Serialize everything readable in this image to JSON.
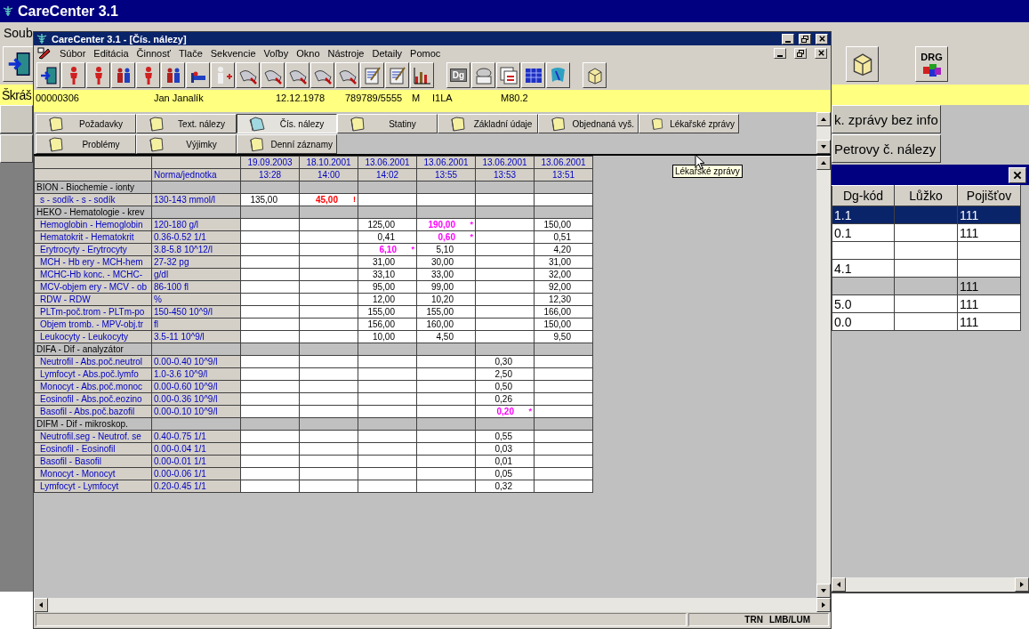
{
  "outer_window": {
    "title": "CareCenter 3.1",
    "menu": [
      "Soub"
    ],
    "toolbar": [
      {
        "kind": "icon"
      },
      {
        "kind": "icon"
      },
      {
        "kind": "label",
        "label": "DRG"
      }
    ],
    "patient_strip": "Škráš",
    "buttons": [
      "k. zprávy bez info",
      "Petrovy č. nálezy"
    ]
  },
  "side_panel": {
    "columns": [
      "Dg-kód",
      "Lůžko",
      "Pojišťov"
    ],
    "rows": [
      {
        "cells": {
          "dg_code": "1.1",
          "insurer": "111"
        },
        "selected": true,
        "shaded": false
      },
      {
        "cells": {
          "dg_code": "0.1",
          "insurer": "111"
        },
        "selected": false,
        "shaded": false
      },
      {
        "cells": {},
        "selected": false,
        "shaded": false
      },
      {
        "cells": {
          "dg_code": "4.1"
        },
        "selected": false,
        "shaded": false
      },
      {
        "cells": {
          "insurer": "111"
        },
        "selected": false,
        "shaded": true
      },
      {
        "cells": {
          "dg_code": "5.0",
          "insurer": "111"
        },
        "selected": false,
        "shaded": false
      },
      {
        "cells": {
          "dg_code": "0.0",
          "insurer": "111"
        },
        "selected": false,
        "shaded": false
      }
    ]
  },
  "inner_window": {
    "title": "CareCenter 3.1 - [Čís. nálezy]",
    "menu": [
      "Súbor",
      "Editácia",
      "Činnosť",
      "Tlače",
      "Sekvencie",
      "Voľby",
      "Okno",
      "Nástroje",
      "Detaily",
      "Pomoc"
    ],
    "toolbar": [
      [
        {
          "kind": "icon"
        },
        {
          "kind": "icon"
        },
        {
          "kind": "icon"
        },
        {
          "kind": "icon"
        },
        {
          "kind": "icon"
        },
        {
          "kind": "icon"
        },
        {
          "kind": "icon"
        },
        {
          "kind": "icon"
        },
        {
          "kind": "icon"
        },
        {
          "kind": "icon"
        },
        {
          "kind": "icon"
        },
        {
          "kind": "icon"
        },
        {
          "kind": "icon"
        },
        {
          "kind": "icon"
        },
        {
          "kind": "icon"
        },
        {
          "kind": "icon"
        }
      ],
      [
        {
          "kind": "label",
          "label": "Dg"
        },
        {
          "kind": "icon"
        },
        {
          "kind": "icon"
        },
        {
          "kind": "icon"
        },
        {
          "kind": "icon"
        }
      ],
      [
        {
          "kind": "icon"
        }
      ]
    ],
    "patient": [
      "00000306",
      "Jan Janalík",
      "12.12.1978",
      "789789/5555",
      "M",
      "I1LA",
      "M80.2"
    ],
    "tabs": [
      [
        {
          "label": "Požadavky",
          "selected": false
        },
        {
          "label": "Text. nálezy",
          "selected": false
        },
        {
          "label": "Čís. nálezy",
          "selected": true
        },
        {
          "label": "Statiny",
          "selected": false
        },
        {
          "label": "Základní údaje",
          "selected": false
        },
        {
          "label": "Objednaná vyš.",
          "selected": false
        },
        {
          "label": "Lékařské zprávy",
          "selected": false
        }
      ],
      [
        {
          "label": "Problémy",
          "selected": false
        },
        {
          "label": "Výjimky",
          "selected": false
        },
        {
          "label": "Denní záznamy",
          "selected": false
        }
      ]
    ],
    "tooltip": "Lékařské zprávy",
    "table": {
      "dates": [
        "19.09.2003",
        "18.10.2001",
        "13.06.2001",
        "13.06.2001",
        "13.06.2001",
        "13.06.2001"
      ],
      "times": [
        "13:28",
        "14:00",
        "14:02",
        "13:55",
        "13:53",
        "13:51"
      ],
      "norm_heading": "Norma/jednotka",
      "rows": [
        {
          "kind": "group",
          "label": "BION - Biochemie - ionty"
        },
        {
          "kind": "test",
          "label": "s - sodík - s - sodík",
          "norm": "130-143 mmol/l",
          "results": {
            "col_1": {
              "value": "135,00"
            },
            "col_2": {
              "value": "45,00",
              "mark": "!",
              "color": "#ff0000"
            }
          }
        },
        {
          "kind": "group",
          "label": "HEKO - Hematologie - krev"
        },
        {
          "kind": "test",
          "label": "Hemoglobin - Hemoglobin",
          "norm": "120-180 g/l",
          "results": {
            "col_3": {
              "value": "125,00"
            },
            "col_4": {
              "value": "190,00",
              "mark": "*",
              "color": "#ff00ff"
            },
            "col_6": {
              "value": "150,00"
            }
          }
        },
        {
          "kind": "test",
          "label": "Hematokrit - Hematokrit",
          "norm": "0.36-0.52 1/1",
          "results": {
            "col_3": {
              "value": "0,41"
            },
            "col_4": {
              "value": "0,60",
              "mark": "*",
              "color": "#ff00ff"
            },
            "col_6": {
              "value": "0,51"
            }
          }
        },
        {
          "kind": "test",
          "label": "Erytrocyty - Erytrocyty",
          "norm": "3.8-5.8 10^12/l",
          "results": {
            "col_3": {
              "value": "6,10",
              "mark": "*",
              "color": "#ff00ff"
            },
            "col_4": {
              "value": "5,10"
            },
            "col_6": {
              "value": "4,20"
            }
          }
        },
        {
          "kind": "test",
          "label": "MCH - Hb ery - MCH-hem",
          "norm": "27-32 pg",
          "results": {
            "col_3": {
              "value": "31,00"
            },
            "col_4": {
              "value": "30,00"
            },
            "col_6": {
              "value": "31,00"
            }
          }
        },
        {
          "kind": "test",
          "label": "MCHC-Hb konc. - MCHC-",
          "norm": "g/dl",
          "results": {
            "col_3": {
              "value": "33,10"
            },
            "col_4": {
              "value": "33,00"
            },
            "col_6": {
              "value": "32,00"
            }
          }
        },
        {
          "kind": "test",
          "label": "MCV-objem ery - MCV - ob",
          "norm": "86-100 fl",
          "results": {
            "col_3": {
              "value": "95,00"
            },
            "col_4": {
              "value": "99,00"
            },
            "col_6": {
              "value": "92,00"
            }
          }
        },
        {
          "kind": "test",
          "label": "RDW - RDW",
          "norm": "%",
          "results": {
            "col_3": {
              "value": "12,00"
            },
            "col_4": {
              "value": "10,20"
            },
            "col_6": {
              "value": "12,30"
            }
          }
        },
        {
          "kind": "test",
          "label": "PLTm-poč.trom - PLTm-po",
          "norm": "150-450 10^9/l",
          "results": {
            "col_3": {
              "value": "155,00"
            },
            "col_4": {
              "value": "155,00"
            },
            "col_6": {
              "value": "166,00"
            }
          }
        },
        {
          "kind": "test",
          "label": "Objem tromb. - MPV-obj.tr",
          "norm": "fl",
          "results": {
            "col_3": {
              "value": "156,00"
            },
            "col_4": {
              "value": "160,00"
            },
            "col_6": {
              "value": "150,00"
            }
          }
        },
        {
          "kind": "test",
          "label": "Leukocyty - Leukocyty",
          "norm": "3.5-11 10^9/l",
          "results": {
            "col_3": {
              "value": "10,00"
            },
            "col_4": {
              "value": "4,50"
            },
            "col_6": {
              "value": "9,50"
            }
          }
        },
        {
          "kind": "group",
          "label": "DIFA - Dif - analyzátor"
        },
        {
          "kind": "test",
          "label": "Neutrofil - Abs.poč.neutrol",
          "norm": "0.00-0.40 10^9/l",
          "results": {
            "col_5": {
              "value": "0,30"
            }
          }
        },
        {
          "kind": "test",
          "label": "Lymfocyt - Abs.poč.lymfo",
          "norm": "1.0-3.6 10^9/l",
          "results": {
            "col_5": {
              "value": "2,50"
            }
          }
        },
        {
          "kind": "test",
          "label": "Monocyt - Abs.poč.monoc",
          "norm": "0.00-0.60 10^9/l",
          "results": {
            "col_5": {
              "value": "0,50"
            }
          }
        },
        {
          "kind": "test",
          "label": "Eosinofil - Abs.poč.eozino",
          "norm": "0.00-0.36 10^9/l",
          "results": {
            "col_5": {
              "value": "0,26"
            }
          }
        },
        {
          "kind": "test",
          "label": "Basofil - Abs.poč.bazofil",
          "norm": "0.00-0.10 10^9/l",
          "results": {
            "col_5": {
              "value": "0,20",
              "mark": "*",
              "color": "#ff00ff"
            }
          }
        },
        {
          "kind": "group",
          "label": "DIFM - Dif - mikroskop."
        },
        {
          "kind": "test",
          "label": "Neutrofil.seg - Neutrof. se",
          "norm": "0.40-0.75 1/1",
          "results": {
            "col_5": {
              "value": "0,55"
            }
          }
        },
        {
          "kind": "test",
          "label": "Eosinofil - Eosinofil",
          "norm": "0.00-0.04 1/1",
          "results": {
            "col_5": {
              "value": "0,03"
            }
          }
        },
        {
          "kind": "test",
          "label": "Basofil - Basofil",
          "norm": "0.00-0.01 1/1",
          "results": {
            "col_5": {
              "value": "0,01"
            }
          }
        },
        {
          "kind": "test",
          "label": "Monocyt - Monocyt",
          "norm": "0.00-0.06 1/1",
          "results": {
            "col_5": {
              "value": "0,05"
            }
          }
        },
        {
          "kind": "test",
          "label": "Lymfocyt - Lymfocyt",
          "norm": "0.20-0.45 1/1",
          "results": {
            "col_5": {
              "value": "0,32"
            }
          }
        }
      ]
    },
    "status_bar": [
      "TRN",
      "LMB/LUM"
    ]
  }
}
